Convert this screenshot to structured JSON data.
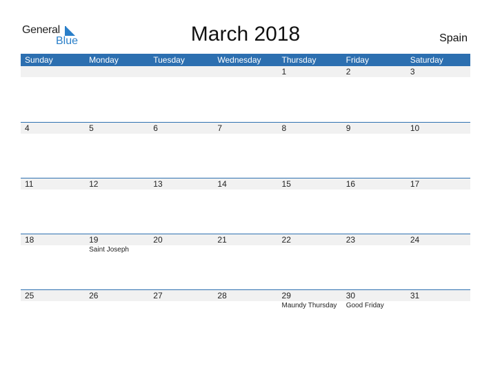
{
  "logo": {
    "general": "General",
    "blue": "Blue",
    "brand_color": "#2a7fc9"
  },
  "title": "March 2018",
  "country": "Spain",
  "colors": {
    "header": "#2c6fb0",
    "band": "#f1f1f1"
  },
  "weekdays": [
    "Sunday",
    "Monday",
    "Tuesday",
    "Wednesday",
    "Thursday",
    "Friday",
    "Saturday"
  ],
  "weeks": [
    {
      "days": [
        {
          "n": ""
        },
        {
          "n": ""
        },
        {
          "n": ""
        },
        {
          "n": ""
        },
        {
          "n": "1"
        },
        {
          "n": "2"
        },
        {
          "n": "3"
        }
      ]
    },
    {
      "days": [
        {
          "n": "4"
        },
        {
          "n": "5"
        },
        {
          "n": "6"
        },
        {
          "n": "7"
        },
        {
          "n": "8"
        },
        {
          "n": "9"
        },
        {
          "n": "10"
        }
      ]
    },
    {
      "days": [
        {
          "n": "11"
        },
        {
          "n": "12"
        },
        {
          "n": "13"
        },
        {
          "n": "14"
        },
        {
          "n": "15"
        },
        {
          "n": "16"
        },
        {
          "n": "17"
        }
      ]
    },
    {
      "days": [
        {
          "n": "18"
        },
        {
          "n": "19",
          "h": "Saint Joseph"
        },
        {
          "n": "20"
        },
        {
          "n": "21"
        },
        {
          "n": "22"
        },
        {
          "n": "23"
        },
        {
          "n": "24"
        }
      ]
    },
    {
      "days": [
        {
          "n": "25"
        },
        {
          "n": "26"
        },
        {
          "n": "27"
        },
        {
          "n": "28"
        },
        {
          "n": "29",
          "h": "Maundy Thursday"
        },
        {
          "n": "30",
          "h": "Good Friday"
        },
        {
          "n": "31"
        }
      ]
    }
  ]
}
